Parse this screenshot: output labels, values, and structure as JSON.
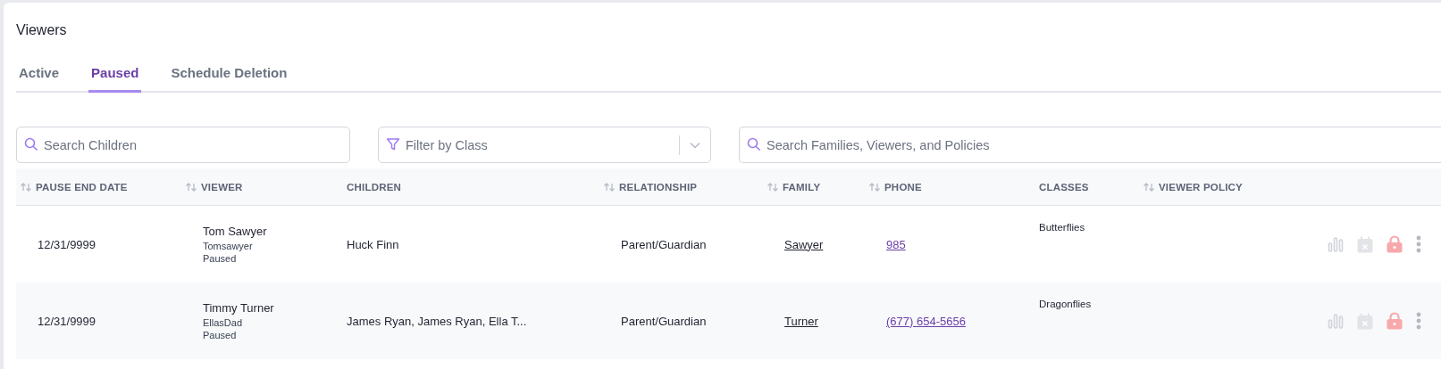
{
  "title": "Viewers",
  "tabs": [
    {
      "label": "Active",
      "selected": false
    },
    {
      "label": "Paused",
      "selected": true
    },
    {
      "label": "Schedule Deletion",
      "selected": false
    }
  ],
  "filters": {
    "children_search": {
      "placeholder": "Search Children"
    },
    "class_filter": {
      "placeholder": "Filter by Class"
    },
    "families_search": {
      "placeholder": "Search Families, Viewers, and Policies"
    }
  },
  "table": {
    "columns": [
      {
        "label": "PAUSE END DATE",
        "sortable": true
      },
      {
        "label": "VIEWER",
        "sortable": true
      },
      {
        "label": "CHILDREN",
        "sortable": false
      },
      {
        "label": "RELATIONSHIP",
        "sortable": true
      },
      {
        "label": "FAMILY",
        "sortable": true
      },
      {
        "label": "PHONE",
        "sortable": true
      },
      {
        "label": "CLASSES",
        "sortable": false
      },
      {
        "label": "VIEWER POLICY",
        "sortable": true
      }
    ],
    "rows": [
      {
        "pause_end_date": "12/31/9999",
        "viewer": {
          "name": "Tom Sawyer",
          "username": "Tomsawyer",
          "status": "Paused"
        },
        "children": "Huck Finn",
        "relationship": "Parent/Guardian",
        "family": "Sawyer",
        "phone": "985",
        "classes": "Butterflies"
      },
      {
        "pause_end_date": "12/31/9999",
        "viewer": {
          "name": "Timmy Turner",
          "username": "EllasDad",
          "status": "Paused"
        },
        "children": "James Ryan, James Ryan, Ella T...",
        "relationship": "Parent/Guardian",
        "family": "Turner",
        "phone": "(677) 654-5656",
        "classes": "Dragonflies"
      }
    ]
  }
}
